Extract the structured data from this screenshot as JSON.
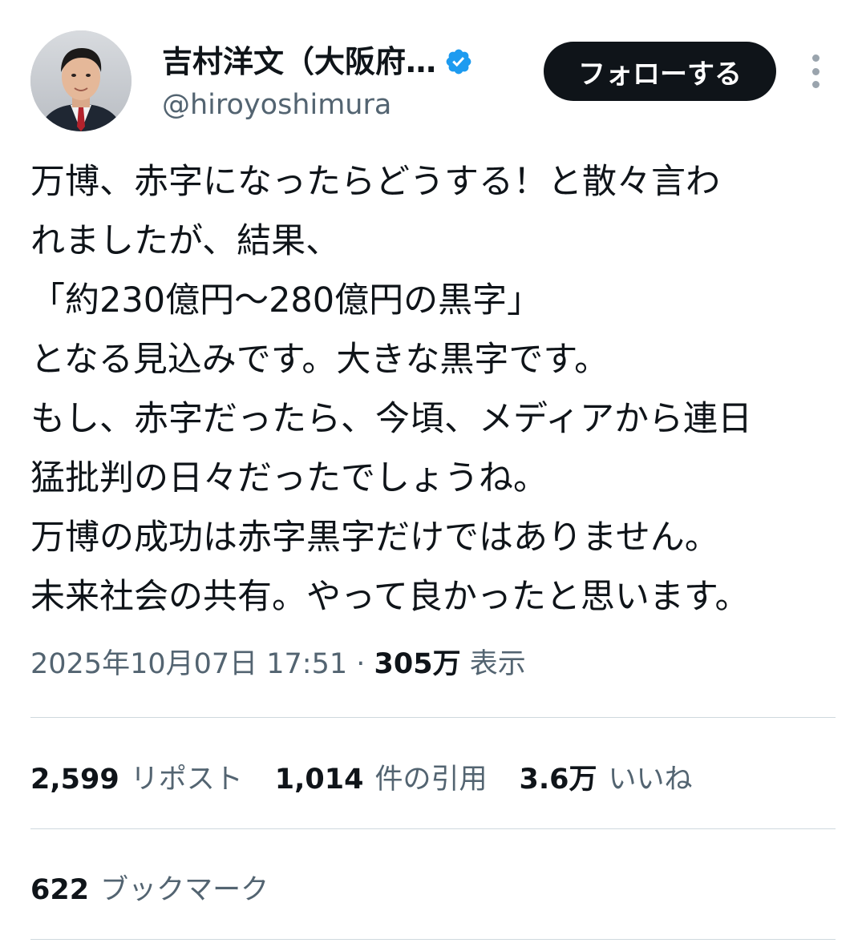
{
  "author": {
    "display_name": "吉村洋文（大阪府…",
    "handle": "@hiroyoshimura",
    "verified_icon": "verified-badge-icon",
    "verified_color": "#1d9bf0"
  },
  "actions": {
    "follow_label": "フォローする",
    "more_icon": "vertical-ellipsis-icon"
  },
  "tweet": {
    "lines": [
      "万博、赤字になったらどうする！と散々言わ",
      "れましたが、結果、",
      "「約230億円〜280億円の黒字」",
      "となる見込みです。大きな黒字です。",
      "もし、赤字だったら、今頃、メディアから連日",
      "猛批判の日々だったでしょうね。",
      "万博の成功は赤字黒字だけではありません。",
      "未来社会の共有。やって良かったと思います。"
    ]
  },
  "meta": {
    "timestamp": "2025年10月07日 17:51",
    "separator": " · ",
    "views_count": "305万",
    "views_label": "表示"
  },
  "stats": {
    "reposts": {
      "count": "2,599",
      "label": "リポスト"
    },
    "quotes": {
      "count": "1,014",
      "label": "件の引用"
    },
    "likes": {
      "count": "3.6万",
      "label": "いいね"
    },
    "bookmarks": {
      "count": "622",
      "label": "ブックマーク"
    }
  },
  "colors": {
    "text_primary": "#0f1419",
    "text_secondary": "#536471",
    "divider": "#cfd9de",
    "button_bg": "#0f1419"
  }
}
